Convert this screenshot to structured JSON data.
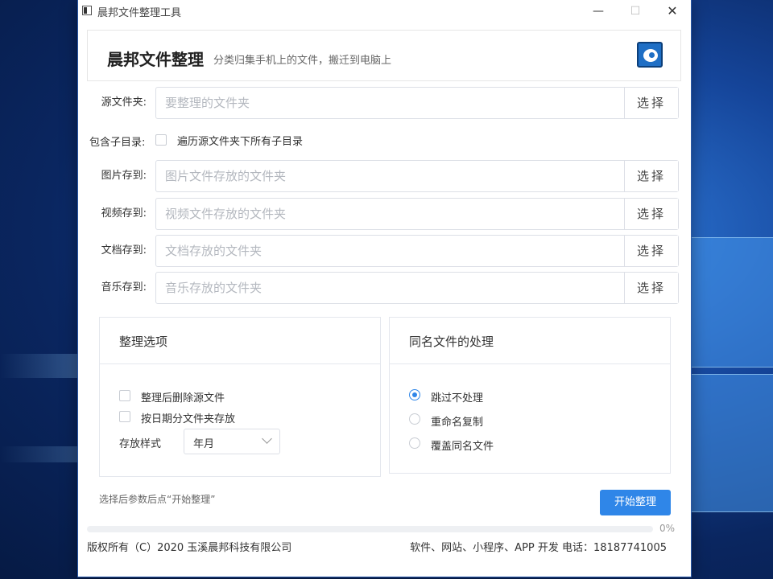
{
  "window": {
    "title": "晨邦文件整理工具",
    "controls": {
      "minimize": "—",
      "maximize": "☐",
      "close": "✕"
    }
  },
  "header": {
    "app_name": "晨邦文件整理",
    "subtitle": "分类归集手机上的文件，搬迁到电脑上",
    "logo_icon": "eye-logo-icon"
  },
  "fields": [
    {
      "label": "源文件夹:",
      "placeholder": "要整理的文件夹",
      "value": "",
      "button": "选择"
    },
    {
      "label": "图片存到:",
      "placeholder": "图片文件存放的文件夹",
      "value": "",
      "button": "选择"
    },
    {
      "label": "视频存到:",
      "placeholder": "视频文件存放的文件夹",
      "value": "",
      "button": "选择"
    },
    {
      "label": "文档存到:",
      "placeholder": "文档存放的文件夹",
      "value": "",
      "button": "选择"
    },
    {
      "label": "音乐存到:",
      "placeholder": "音乐存放的文件夹",
      "value": "",
      "button": "选择"
    }
  ],
  "include_subdirs": {
    "label": "包含子目录:",
    "text": "遍历源文件夹下所有子目录",
    "checked": false
  },
  "options_panel": {
    "title": "整理选项",
    "checkboxes": [
      {
        "label": "整理后删除源文件",
        "checked": false
      },
      {
        "label": "按日期分文件夹存放",
        "checked": false
      }
    ],
    "style_label": "存放样式",
    "style_value": "年月"
  },
  "dup_panel": {
    "title": "同名文件的处理",
    "radios": [
      {
        "label": "跳过不处理",
        "selected": true
      },
      {
        "label": "重命名复制",
        "selected": false
      },
      {
        "label": "覆盖同名文件",
        "selected": false
      }
    ]
  },
  "hint": "选择后参数后点“开始整理”",
  "start_button": "开始整理",
  "progress": {
    "percent": 0,
    "text": "0%"
  },
  "footer": {
    "copyright": "版权所有（C）2020 玉溪晨邦科技有限公司",
    "contact": "软件、网站、小程序、APP 开发 电话：18187741005"
  },
  "colors": {
    "accent": "#2f86e8",
    "border": "#dcdfe6",
    "placeholder": "#b4b8bf"
  }
}
